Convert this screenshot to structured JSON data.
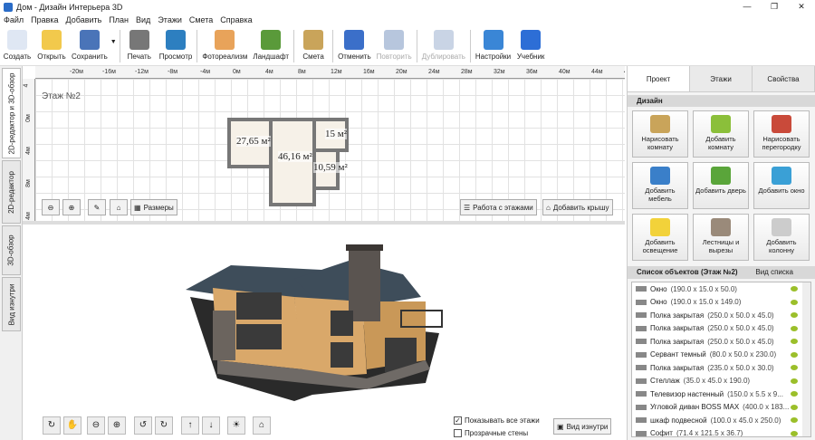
{
  "window": {
    "title": "Дом - Дизайн Интерьера 3D"
  },
  "menu": [
    "Файл",
    "Правка",
    "Добавить",
    "План",
    "Вид",
    "Этажи",
    "Смета",
    "Справка"
  ],
  "toolbar": [
    {
      "label": "Создать",
      "icon": "new-file-icon",
      "color": "#dfe7f3",
      "enabled": true
    },
    {
      "label": "Открыть",
      "icon": "folder-icon",
      "color": "#f2c94c",
      "enabled": true
    },
    {
      "label": "Сохранить",
      "icon": "floppy-icon",
      "color": "#4a74b8",
      "enabled": true
    },
    {
      "label": "Печать",
      "icon": "printer-icon",
      "color": "#777",
      "enabled": true
    },
    {
      "label": "Просмотр",
      "icon": "monitor-icon",
      "color": "#2d7fc0",
      "enabled": true
    },
    {
      "label": "Фотореализм",
      "icon": "photo-icon",
      "color": "#e8a35a",
      "enabled": true
    },
    {
      "label": "Ландшафт",
      "icon": "tree-icon",
      "color": "#5a9a3a",
      "enabled": true
    },
    {
      "label": "Смета",
      "icon": "notepad-icon",
      "color": "#c9a45a",
      "enabled": true
    },
    {
      "label": "Отменить",
      "icon": "undo-icon",
      "color": "#3b6fc9",
      "enabled": true
    },
    {
      "label": "Повторить",
      "icon": "redo-icon",
      "color": "#b7c6dd",
      "enabled": false
    },
    {
      "label": "Дублировать",
      "icon": "duplicate-icon",
      "color": "#c9d4e5",
      "enabled": false
    },
    {
      "label": "Настройки",
      "icon": "gear-icon",
      "color": "#3a86d6",
      "enabled": true
    },
    {
      "label": "Учебник",
      "icon": "help-icon",
      "color": "#2d6ed6",
      "enabled": true
    }
  ],
  "left_tabs": [
    "2D-редактор и 3D-обзор",
    "2D-редактор",
    "3D-обзор",
    "Вид изнутри"
  ],
  "plan": {
    "floor_label": "Этаж №2",
    "ruler_x": [
      "-20м",
      "-16м",
      "-12м",
      "-8м",
      "-4м",
      "0м",
      "4м",
      "8м",
      "12м",
      "16м",
      "20м",
      "24м",
      "28м",
      "32м",
      "36м",
      "40м",
      "44м",
      "48м"
    ],
    "ruler_y": [
      "4",
      "0м",
      "4м",
      "8м",
      "4м"
    ],
    "rooms": [
      {
        "label": "27,65 м²"
      },
      {
        "label": "46,16 м²"
      },
      {
        "label": "15 м²"
      },
      {
        "label": "10,59 м²"
      }
    ],
    "buttons": {
      "sizes": "Размеры",
      "floors": "Работа с этажами",
      "roof": "Добавить крышу"
    }
  },
  "view3d": {
    "show_all_floors": "Показывать все этажи",
    "transparent_walls": "Прозрачные стены",
    "inside_view": "Вид изнутри",
    "show_all_checked": true,
    "transparent_checked": false
  },
  "right_panel": {
    "tabs": [
      "Проект",
      "Этажи",
      "Свойства"
    ],
    "design_header": "Дизайн",
    "design_buttons": [
      {
        "label": "Нарисовать комнату",
        "icon": "draw-room-icon",
        "color": "#c9a45a"
      },
      {
        "label": "Добавить комнату",
        "icon": "add-room-icon",
        "color": "#8bbf3a"
      },
      {
        "label": "Нарисовать перегородку",
        "icon": "brick-wall-icon",
        "color": "#c94a3a"
      },
      {
        "label": "Добавить мебель",
        "icon": "chair-icon",
        "color": "#3a7fc9"
      },
      {
        "label": "Добавить дверь",
        "icon": "door-icon",
        "color": "#5aa53a"
      },
      {
        "label": "Добавить окно",
        "icon": "window-icon",
        "color": "#3aa0d6"
      },
      {
        "label": "Добавить освещение",
        "icon": "bulb-icon",
        "color": "#f2d23a"
      },
      {
        "label": "Лестницы и вырезы",
        "icon": "stairs-icon",
        "color": "#9a8a7a"
      },
      {
        "label": "Добавить колонну",
        "icon": "column-icon",
        "color": "#ccc"
      }
    ],
    "list_header": "Список объектов (Этаж №2)",
    "list_view": "Вид списка",
    "objects": [
      {
        "name": "Окно",
        "dims": "(190.0 x 15.0 x 50.0)"
      },
      {
        "name": "Окно",
        "dims": "(190.0 x 15.0 x 149.0)"
      },
      {
        "name": "Полка закрытая",
        "dims": "(250.0 x 50.0 x 45.0)"
      },
      {
        "name": "Полка закрытая",
        "dims": "(250.0 x 50.0 x 45.0)"
      },
      {
        "name": "Полка закрытая",
        "dims": "(250.0 x 50.0 x 45.0)"
      },
      {
        "name": "Сервант темный",
        "dims": "(80.0 x 50.0 x 230.0)"
      },
      {
        "name": "Полка закрытая",
        "dims": "(235.0 x 50.0 x 30.0)"
      },
      {
        "name": "Стеллаж",
        "dims": "(35.0 x 45.0 x 190.0)"
      },
      {
        "name": "Телевизор настенный",
        "dims": "(150.0 x 5.5 x 9..."
      },
      {
        "name": "Угловой диван BOSS MAX",
        "dims": "(400.0 x 183..."
      },
      {
        "name": "шкаф подвесной",
        "dims": "(100.0 x 45.0 x 250.0)"
      },
      {
        "name": "Софит",
        "dims": "(71.4 x 121.5 x 36.7)"
      }
    ]
  }
}
